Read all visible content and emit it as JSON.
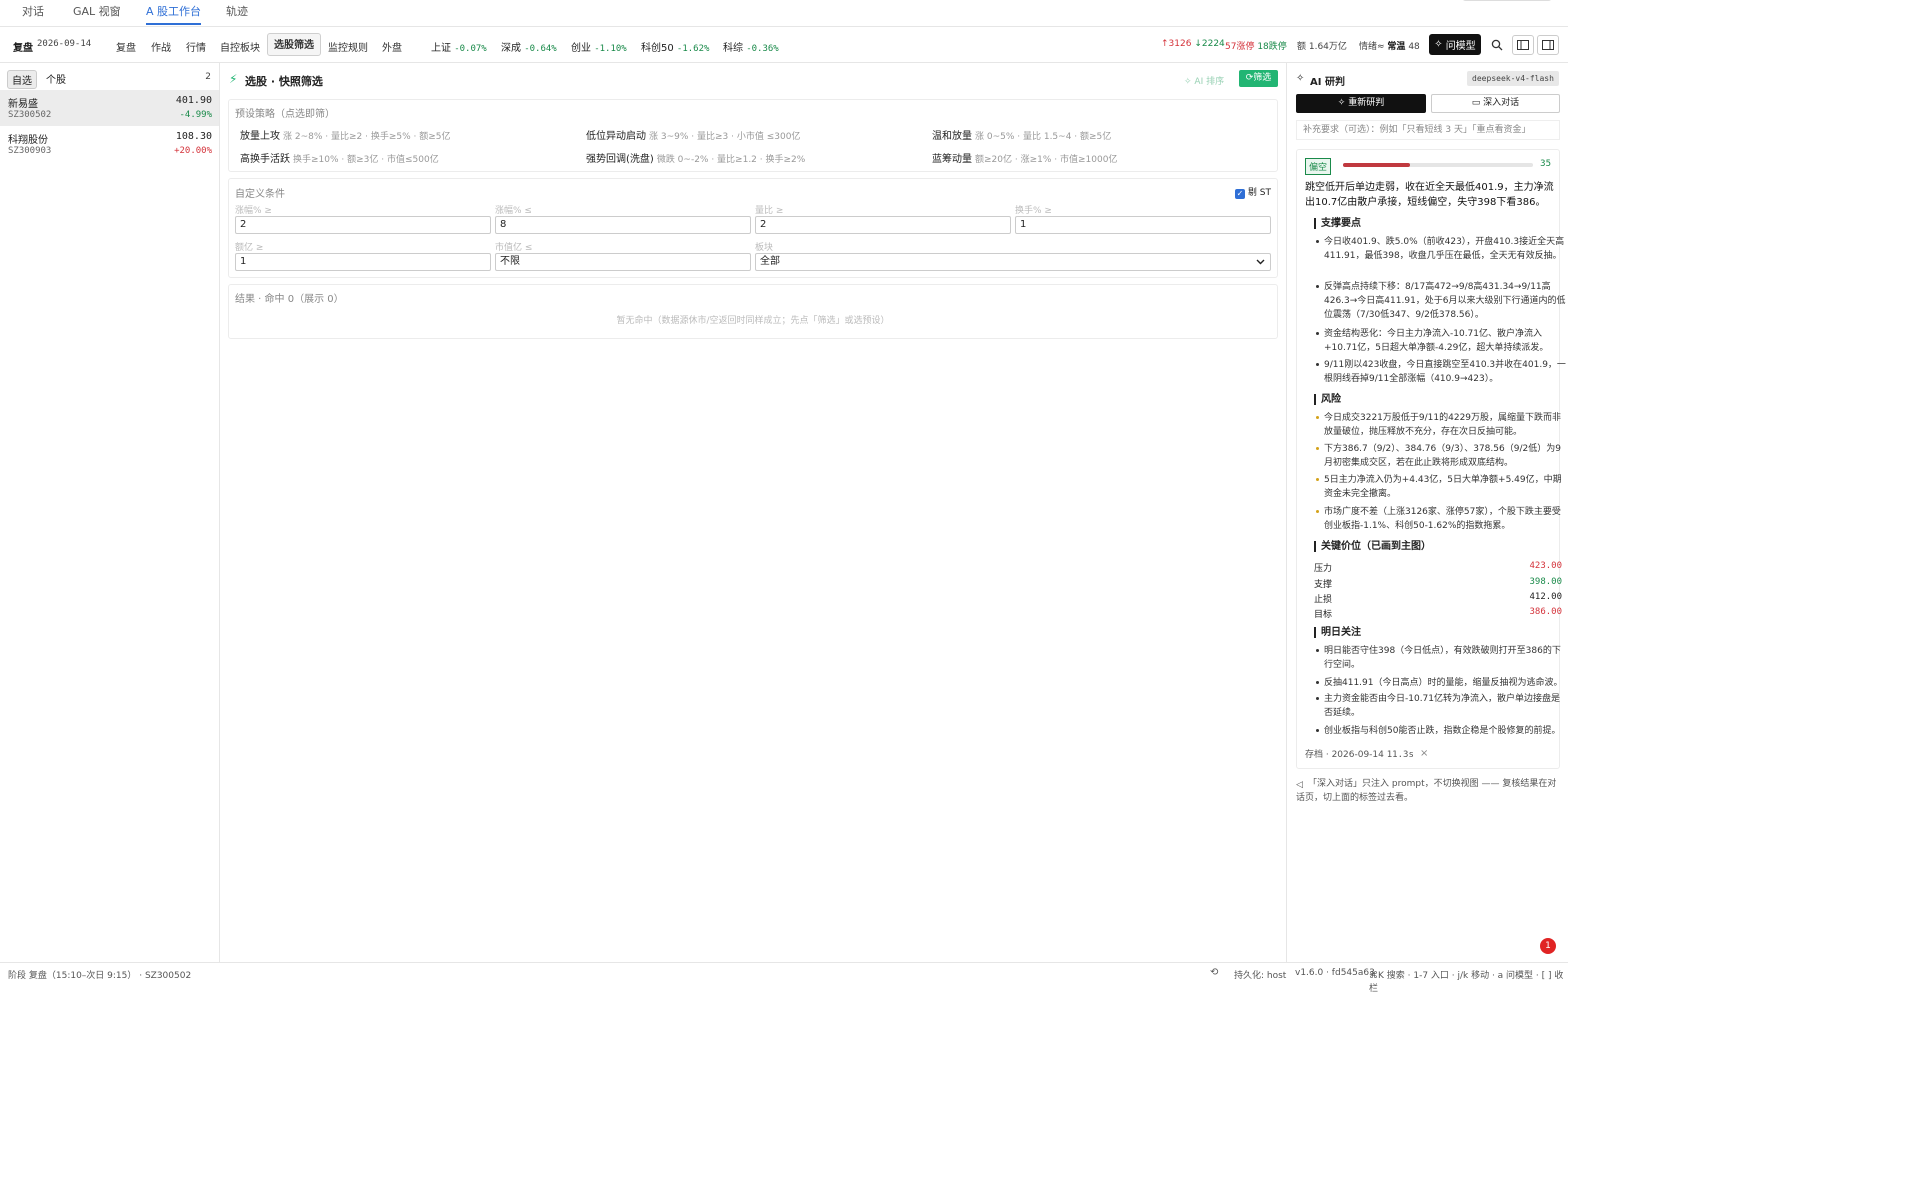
{
  "top_tabs": [
    "对话",
    "GAL 视窗",
    "A 股工作台",
    "轨迹"
  ],
  "nav": {
    "mode": "复盘",
    "date": "2026-09-14",
    "items": [
      "复盘",
      "作战",
      "行情",
      "自控板块",
      "选股筛选",
      "监控规则",
      "外盘"
    ],
    "active": "选股筛选",
    "indices": [
      {
        "name": "上证",
        "change": "-0.07%"
      },
      {
        "name": "深成",
        "change": "-0.64%"
      },
      {
        "name": "创业",
        "change": "-1.10%"
      },
      {
        "name": "科创50",
        "change": "-1.62%"
      },
      {
        "name": "科综",
        "change": "-0.36%"
      }
    ],
    "breadth_up": "↑3126",
    "breadth_down": "↓2224",
    "limit_up": "57涨停",
    "limit_down": "18跌停",
    "volume": "额 1.64万亿",
    "sentiment_label": "情绪≈",
    "sentiment_state": "常温",
    "sentiment_value": "48",
    "ask_model_label": "问模型"
  },
  "sidebar": {
    "tabs": [
      "自选",
      "个股"
    ],
    "count": "2",
    "stocks": [
      {
        "name": "新易盛",
        "code": "SZ300502",
        "price": "401.90",
        "change": "-4.99%"
      },
      {
        "name": "科翔股份",
        "code": "SZ300903",
        "price": "108.30",
        "change": "+20.00%"
      }
    ]
  },
  "screener": {
    "title": "选股 · 快照筛选",
    "ai_sort_label": "AI 排序",
    "filter_label": "筛选",
    "preset_title": "预设策略（点选即筛）",
    "presets": [
      {
        "name": "放量上攻",
        "desc": "涨 2~8% · 量比≥2 · 换手≥5% · 额≥5亿"
      },
      {
        "name": "低位异动启动",
        "desc": "涨 3~9% · 量比≥3 · 小市值 ≤300亿"
      },
      {
        "name": "温和放量",
        "desc": "涨 0~5% · 量比 1.5~4 · 额≥5亿"
      },
      {
        "name": "高换手活跃",
        "desc": "换手≥10% · 额≥3亿 · 市值≤500亿"
      },
      {
        "name": "强势回调(洗盘)",
        "desc": "微跌 0~-2% · 量比≥1.2 · 换手≥2%"
      },
      {
        "name": "蓝筹动量",
        "desc": "额≥20亿 · 涨≥1% · 市值≥1000亿"
      }
    ],
    "custom_title": "自定义条件",
    "exclude_st_label": "剔 ST",
    "fields": [
      {
        "label": "涨幅% ≥",
        "value": "2"
      },
      {
        "label": "涨幅% ≤",
        "value": "8"
      },
      {
        "label": "量比 ≥",
        "value": "2"
      },
      {
        "label": "换手% ≥",
        "value": "1"
      },
      {
        "label": "额亿 ≥",
        "value": "1"
      },
      {
        "label": "市值亿 ≤",
        "value": "不限"
      },
      {
        "label": "板块",
        "value": "全部"
      }
    ],
    "result_title": "结果 · 命中 0（展示 0）",
    "empty_text": "暂无命中（数据源休市/空返回时同样成立；先点「筛选」或选预设）"
  },
  "research": {
    "title": "AI 研判",
    "model": "deepseek-v4-flash",
    "rerun_label": "重新研判",
    "deep_label": "深入对话",
    "hint": "补充要求（可选）：例如「只看短线 3 天」「重点看资金」",
    "stance": "偏空",
    "score": "35",
    "score_fraction": 0.35,
    "summary": "跳空低开后单边走弱，收在近全天最低401.9，主力净流出10.7亿由散户承接，短线偏空，失守398下看386。",
    "support_title": "支撑要点",
    "support_points": [
      "今日收401.9、跌5.0%（前收423），开盘410.3接近全天高411.91，最低398，收盘几乎压在最低，全天无有效反抽。",
      "反弹高点持续下移：8/17高472→9/8高431.34→9/11高426.3→今日高411.91，处于6月以来大级别下行通道内的低位震荡（7/30低347、9/2低378.56）。",
      "资金结构恶化：今日主力净流入-10.71亿、散户净流入+10.71亿，5日超大单净额-4.29亿，超大单持续派发。",
      "9/11刚以423收盘，今日直接跳空至410.3并收在401.9，一根阴线吞掉9/11全部涨幅（410.9→423）。"
    ],
    "risk_title": "风险",
    "risk_points": [
      "今日成交3221万股低于9/11的4229万股，属缩量下跌而非放量破位，抛压释放不充分，存在次日反抽可能。",
      "下方386.7（9/2）、384.76（9/3）、378.56（9/2低）为9月初密集成交区，若在此止跌将形成双底结构。",
      "5日主力净流入仍为+4.43亿，5日大单净额+5.49亿，中期资金未完全撤离。",
      "市场广度不差（上涨3126家、涨停57家），个股下跌主要受创业板指-1.1%、科创50-1.62%的指数拖累。"
    ],
    "keylevel_title": "关键价位（已画到主图）",
    "key_levels": [
      {
        "name": "压力",
        "value": "423.00",
        "color": "#d4333b"
      },
      {
        "name": "支撑",
        "value": "398.00",
        "color": "#1a8a4a"
      },
      {
        "name": "止损",
        "value": "412.00",
        "color": "#222222"
      },
      {
        "name": "目标",
        "value": "386.00",
        "color": "#d4333b"
      }
    ],
    "watch_title": "明日关注",
    "watch_points": [
      "明日能否守住398（今日低点），有效跌破则打开至386的下行空间。",
      "反抽411.91（今日高点）时的量能，缩量反抽视为逃命波。",
      "主力资金能否由今日-10.71亿转为净流入，散户单边接盘是否延续。",
      "创业板指与科创50能否止跌，指数企稳是个股修复的前提。"
    ],
    "archive_label": "存档 · 2026-09-14",
    "archive_time": "11.3s",
    "note": "「深入对话」只注入 prompt，不切换视图 —— 复核结果在对话页，切上面的标签过去看。",
    "notif_count": "1"
  },
  "footer": {
    "left": "阶段 复盘（15:10–次日 9:15） · SZ300502",
    "persist": "持久化: host",
    "version": "v1.6.0 · fd545a63",
    "shortcuts": "⌘K 搜索 · 1-7 入口 · j/k 移动 · a 问模型 · [ ] 收栏"
  },
  "colors": {
    "accent": "#2f6fd6",
    "up": "#d4333b",
    "down": "#1a8a4a",
    "filter_btn": "#22b573"
  }
}
